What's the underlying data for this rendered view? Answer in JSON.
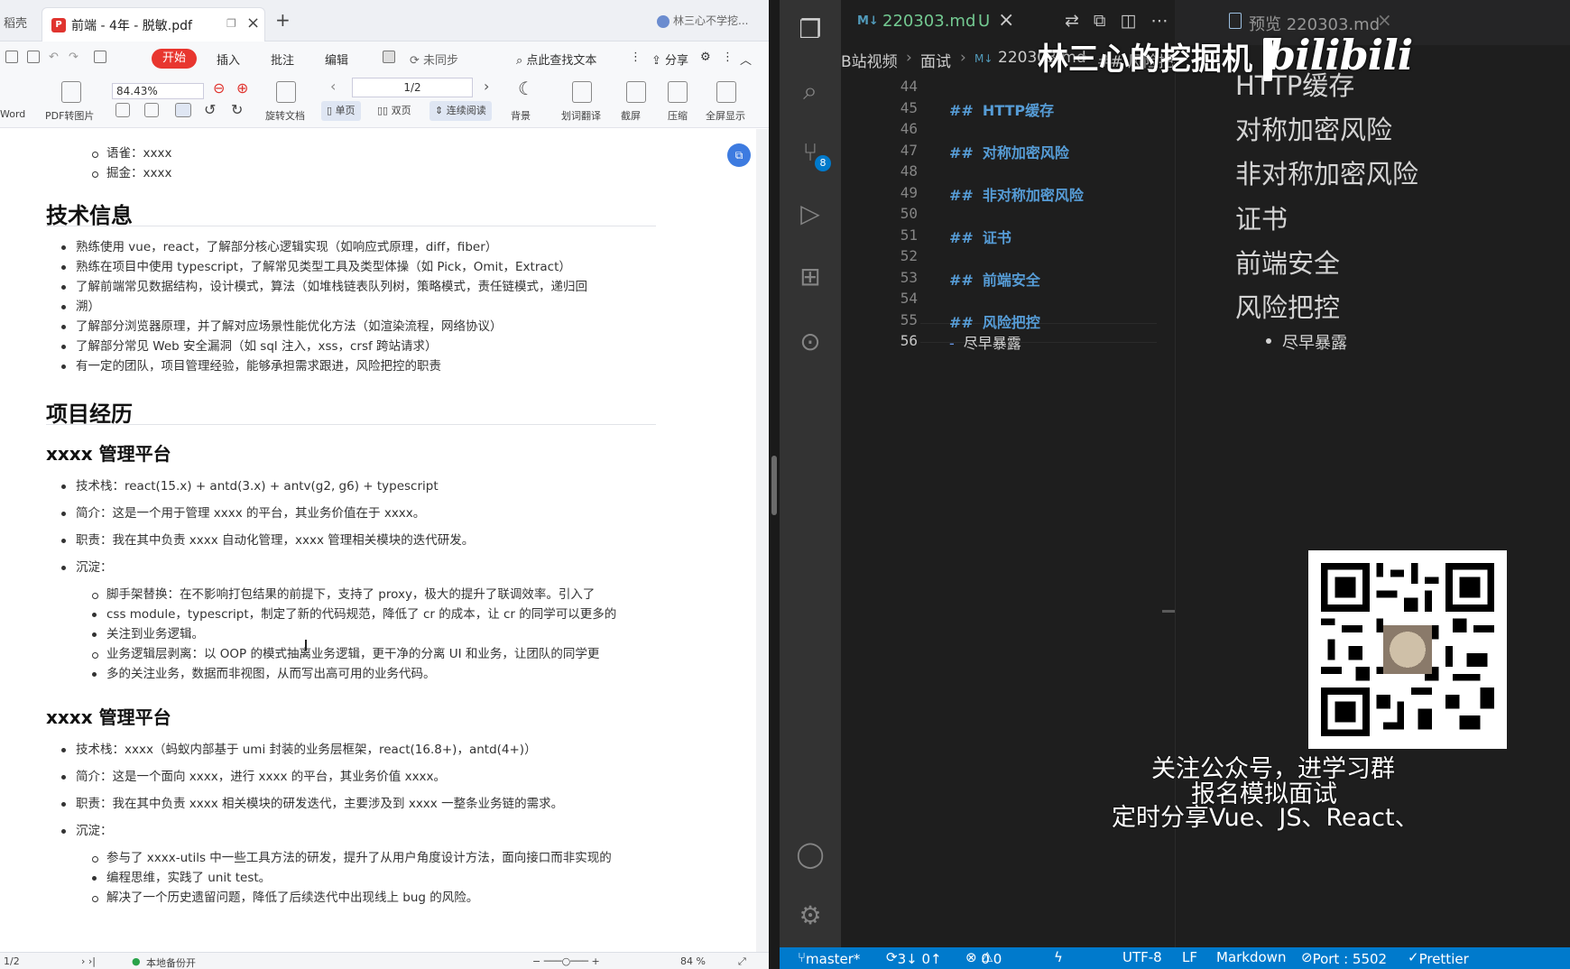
{
  "pdf": {
    "app_label": "稻壳",
    "tab_title": "前端 - 4年 - 脱敏.pdf",
    "user_label": "林三心不学挖...",
    "menu": [
      "开始",
      "插入",
      "批注",
      "编辑",
      "未同步",
      "点此查找文本",
      "分享"
    ],
    "toolbar": {
      "to_word": "Word",
      "pdf_to_image": "PDF转图片",
      "zoom": "84.43%",
      "rotate": "旋转文档",
      "page": "1/2",
      "single": "单页",
      "double": "双页",
      "continuous": "连续阅读",
      "background": "背景",
      "translate": "划词翻译",
      "screenshot": "截屏",
      "compress": "压缩",
      "fullscreen": "全屏显示"
    },
    "doc": {
      "top_sub": [
        "语雀：xxxx",
        "掘金：xxxx"
      ],
      "tech_heading": "技术信息",
      "tech_items": [
        "熟练使用 vue，react，了解部分核心逻辑实现（如响应式原理，diff，fiber）",
        "熟练在项目中使用 typescript，了解常见类型工具及类型体操（如 Pick，Omit，Extract）",
        "了解前端常见数据结构，设计模式，算法（如堆栈链表队列树，策略模式，责任链模式，递归回",
        "溯）",
        "了解部分浏览器原理，并了解对应场景性能优化方法（如渲染流程，网络协议）",
        "了解部分常见 Web 安全漏洞（如 sql 注入，xss，crsf 跨站请求）",
        "有一定的团队，项目管理经验，能够承担需求跟进，风险把控的职责"
      ],
      "project_heading": "项目经历",
      "proj1_title": "xxxx 管理平台",
      "proj1_items": [
        "技术栈：react(15.x) + antd(3.x) + antv(g2, g6) + typescript",
        "简介：这是一个用于管理 xxxx 的平台，其业务价值在于 xxxx。",
        "职责：我在其中负责 xxxx 自动化管理，xxxx 管理相关模块的迭代研发。",
        "沉淀："
      ],
      "proj1_sub": [
        "脚手架替换：在不影响打包结果的前提下，支持了 proxy，极大的提升了联调效率。引入了",
        "css module，typescript，制定了新的代码规范，降低了 cr 的成本，让 cr 的同学可以更多的",
        "关注到业务逻辑。",
        "业务逻辑层剥离：以 OOP 的模式抽离业务逻辑，更干净的分离 UI 和业务，让团队的同学更",
        "多的关注业务，数据而非视图，从而写出高可用的业务代码。"
      ],
      "proj2_title": "xxxx 管理平台",
      "proj2_items": [
        "技术栈：xxxx（蚂蚁内部基于 umi 封装的业务层框架，react(16.8+)，antd(4+)）",
        "简介：这是一个面向 xxxx，进行 xxxx 的平台，其业务价值 xxxx。",
        "职责：我在其中负责 xxxx 相关模块的研发迭代，主要涉及到 xxxx 一整条业务链的需求。",
        "沉淀："
      ],
      "proj2_sub": [
        "参与了 xxxx-utils 中一些工具方法的研发，提升了从用户角度设计方法，面向接口而非实现的",
        "编程思维，实践了 unit test。",
        "解决了一个历史遗留问题，降低了后续迭代中出现线上 bug 的风险。"
      ]
    },
    "status": {
      "page": "1/2",
      "backup": "本地备份开",
      "zoom": "84 %"
    }
  },
  "vscode": {
    "editor_tab": "220303.md",
    "editor_tab_state": "U",
    "preview_tab": "预览 220303.md",
    "breadcrumb": [
      "B站视频",
      "面试",
      "220303.md",
      "## 风险把控"
    ],
    "scm_badge": "8",
    "lines": [
      {
        "n": "44",
        "text": ""
      },
      {
        "n": "45",
        "text": "HTTP缓存",
        "h": true
      },
      {
        "n": "46",
        "text": ""
      },
      {
        "n": "47",
        "text": "对称加密风险",
        "h": true
      },
      {
        "n": "48",
        "text": ""
      },
      {
        "n": "49",
        "text": "非对称加密风险",
        "h": true
      },
      {
        "n": "50",
        "text": ""
      },
      {
        "n": "51",
        "text": "证书",
        "h": true
      },
      {
        "n": "52",
        "text": ""
      },
      {
        "n": "53",
        "text": "前端安全",
        "h": true
      },
      {
        "n": "54",
        "text": ""
      },
      {
        "n": "55",
        "text": "风险把控",
        "h": true
      },
      {
        "n": "56",
        "text": "尽早暴露",
        "h": false
      }
    ],
    "heading_mark": "##",
    "list_mark": "-",
    "preview": {
      "headings": [
        "HTTP缓存",
        "对称加密风险",
        "非对称加密风险",
        "证书",
        "前端安全",
        "风险把控"
      ],
      "list_item": "尽早暴露"
    },
    "ad": {
      "line1": "关注公众号，进学习群",
      "line2": "报名模拟面试",
      "line3": "定时分享Vue、JS、React、"
    },
    "status": {
      "branch": "master*",
      "sync": "3↓ 0↑",
      "errors": "0",
      "warnings": "0",
      "encoding": "UTF-8",
      "eol": "LF",
      "language": "Markdown",
      "port": "Port : 5502",
      "prettier": "Prettier"
    }
  },
  "watermark": {
    "text": "林三心的挖掘机",
    "logo": "bilibili"
  },
  "colors": {
    "vscode_accent": "#007acc",
    "md_heading": "#569cd6",
    "pdf_start": "#e8362f"
  }
}
